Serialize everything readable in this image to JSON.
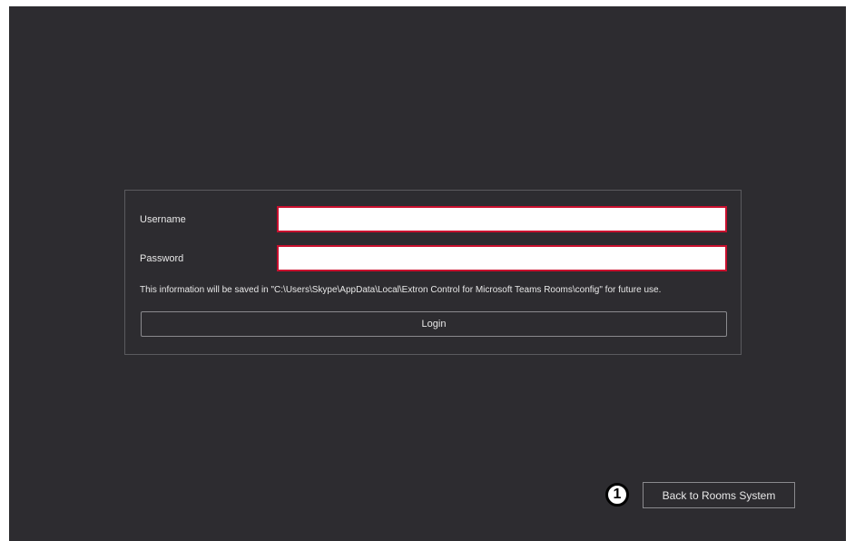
{
  "login_form": {
    "username_label": "Username",
    "username_value": "",
    "password_label": "Password",
    "password_value": "",
    "info_text": "This information will be saved in \"C:\\Users\\Skype\\AppData\\Local\\Extron Control for Microsoft Teams Rooms\\config\" for future use.",
    "login_label": "Login"
  },
  "footer": {
    "back_label": "Back to Rooms System",
    "callout_number": "1"
  },
  "colors": {
    "background": "#2d2c30",
    "input_border_error": "#c8102e",
    "text": "#e8e8e8"
  }
}
